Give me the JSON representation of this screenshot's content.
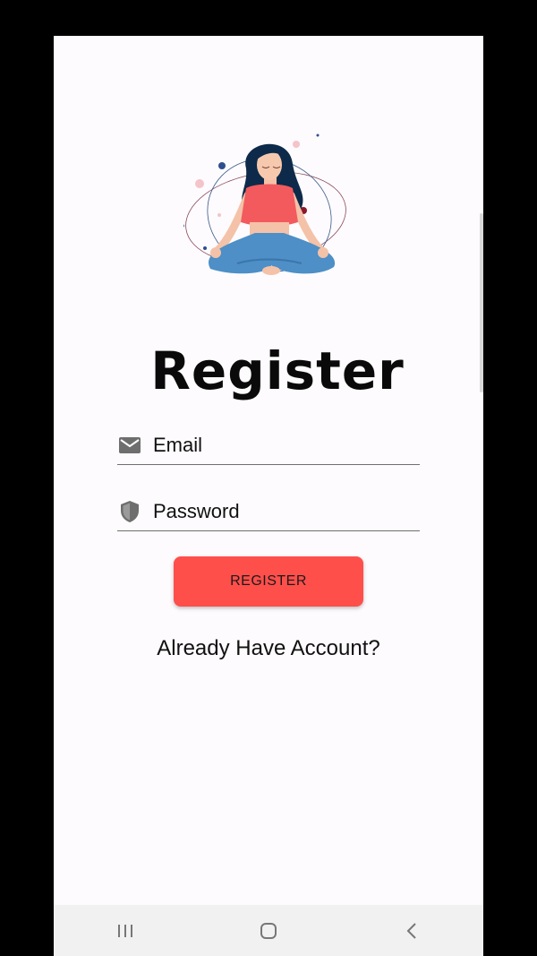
{
  "screen": {
    "title": "Register",
    "illustration": "meditating-woman-illustration"
  },
  "form": {
    "email": {
      "icon": "mail-icon",
      "placeholder": "Email",
      "value": ""
    },
    "password": {
      "icon": "shield-icon",
      "placeholder": "Password",
      "value": ""
    },
    "register_label": "REGISTER",
    "login_link": "Already Have Account?"
  },
  "nav_bar": {
    "items": [
      "recent-apps-icon",
      "home-icon",
      "back-icon"
    ]
  },
  "colors": {
    "accent": "#ff4f4b",
    "background": "#fdfbfd",
    "text": "#111111"
  }
}
